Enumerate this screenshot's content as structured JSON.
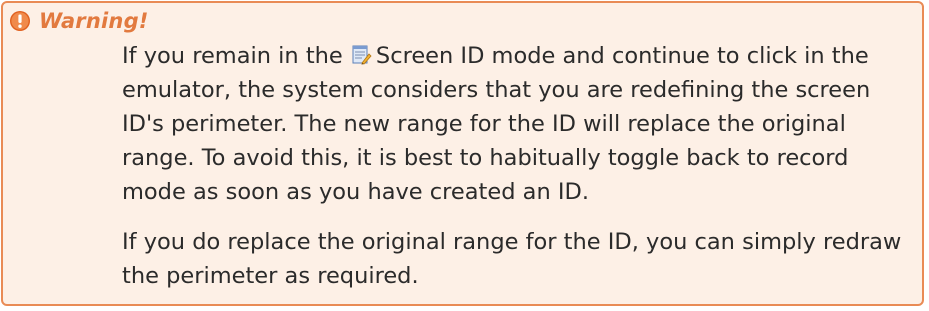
{
  "warning": {
    "title": "Warning!",
    "icon": "exclamation-circle-icon",
    "accent_color": "#e98b55",
    "background_color": "#fdf0e6",
    "paragraph1_before_icon": "If you remain in the ",
    "inline_icon": "screen-id-icon",
    "paragraph1_after_icon": "Screen ID mode and continue to click in the emulator, the system considers that you are redefining the screen ID's perimeter. The new range for the ID will replace the original range. To avoid this, it is best to habitually toggle back to record mode as soon as you have created an ID.",
    "paragraph2": "If you do replace the original range for the ID, you can simply redraw the perimeter as required."
  }
}
